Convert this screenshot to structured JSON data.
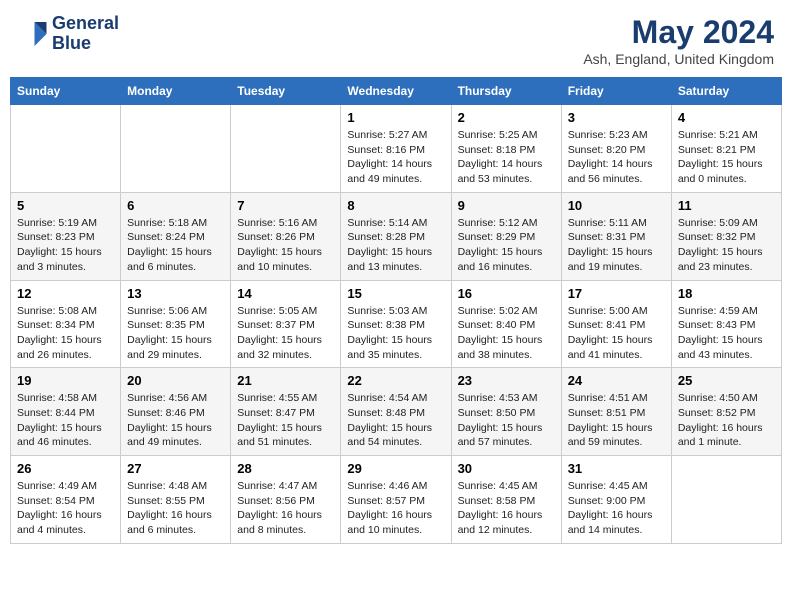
{
  "header": {
    "logo_line1": "General",
    "logo_line2": "Blue",
    "month_title": "May 2024",
    "location": "Ash, England, United Kingdom"
  },
  "weekdays": [
    "Sunday",
    "Monday",
    "Tuesday",
    "Wednesday",
    "Thursday",
    "Friday",
    "Saturday"
  ],
  "weeks": [
    [
      {
        "day": "",
        "info": ""
      },
      {
        "day": "",
        "info": ""
      },
      {
        "day": "",
        "info": ""
      },
      {
        "day": "1",
        "info": "Sunrise: 5:27 AM\nSunset: 8:16 PM\nDaylight: 14 hours\nand 49 minutes."
      },
      {
        "day": "2",
        "info": "Sunrise: 5:25 AM\nSunset: 8:18 PM\nDaylight: 14 hours\nand 53 minutes."
      },
      {
        "day": "3",
        "info": "Sunrise: 5:23 AM\nSunset: 8:20 PM\nDaylight: 14 hours\nand 56 minutes."
      },
      {
        "day": "4",
        "info": "Sunrise: 5:21 AM\nSunset: 8:21 PM\nDaylight: 15 hours\nand 0 minutes."
      }
    ],
    [
      {
        "day": "5",
        "info": "Sunrise: 5:19 AM\nSunset: 8:23 PM\nDaylight: 15 hours\nand 3 minutes."
      },
      {
        "day": "6",
        "info": "Sunrise: 5:18 AM\nSunset: 8:24 PM\nDaylight: 15 hours\nand 6 minutes."
      },
      {
        "day": "7",
        "info": "Sunrise: 5:16 AM\nSunset: 8:26 PM\nDaylight: 15 hours\nand 10 minutes."
      },
      {
        "day": "8",
        "info": "Sunrise: 5:14 AM\nSunset: 8:28 PM\nDaylight: 15 hours\nand 13 minutes."
      },
      {
        "day": "9",
        "info": "Sunrise: 5:12 AM\nSunset: 8:29 PM\nDaylight: 15 hours\nand 16 minutes."
      },
      {
        "day": "10",
        "info": "Sunrise: 5:11 AM\nSunset: 8:31 PM\nDaylight: 15 hours\nand 19 minutes."
      },
      {
        "day": "11",
        "info": "Sunrise: 5:09 AM\nSunset: 8:32 PM\nDaylight: 15 hours\nand 23 minutes."
      }
    ],
    [
      {
        "day": "12",
        "info": "Sunrise: 5:08 AM\nSunset: 8:34 PM\nDaylight: 15 hours\nand 26 minutes."
      },
      {
        "day": "13",
        "info": "Sunrise: 5:06 AM\nSunset: 8:35 PM\nDaylight: 15 hours\nand 29 minutes."
      },
      {
        "day": "14",
        "info": "Sunrise: 5:05 AM\nSunset: 8:37 PM\nDaylight: 15 hours\nand 32 minutes."
      },
      {
        "day": "15",
        "info": "Sunrise: 5:03 AM\nSunset: 8:38 PM\nDaylight: 15 hours\nand 35 minutes."
      },
      {
        "day": "16",
        "info": "Sunrise: 5:02 AM\nSunset: 8:40 PM\nDaylight: 15 hours\nand 38 minutes."
      },
      {
        "day": "17",
        "info": "Sunrise: 5:00 AM\nSunset: 8:41 PM\nDaylight: 15 hours\nand 41 minutes."
      },
      {
        "day": "18",
        "info": "Sunrise: 4:59 AM\nSunset: 8:43 PM\nDaylight: 15 hours\nand 43 minutes."
      }
    ],
    [
      {
        "day": "19",
        "info": "Sunrise: 4:58 AM\nSunset: 8:44 PM\nDaylight: 15 hours\nand 46 minutes."
      },
      {
        "day": "20",
        "info": "Sunrise: 4:56 AM\nSunset: 8:46 PM\nDaylight: 15 hours\nand 49 minutes."
      },
      {
        "day": "21",
        "info": "Sunrise: 4:55 AM\nSunset: 8:47 PM\nDaylight: 15 hours\nand 51 minutes."
      },
      {
        "day": "22",
        "info": "Sunrise: 4:54 AM\nSunset: 8:48 PM\nDaylight: 15 hours\nand 54 minutes."
      },
      {
        "day": "23",
        "info": "Sunrise: 4:53 AM\nSunset: 8:50 PM\nDaylight: 15 hours\nand 57 minutes."
      },
      {
        "day": "24",
        "info": "Sunrise: 4:51 AM\nSunset: 8:51 PM\nDaylight: 15 hours\nand 59 minutes."
      },
      {
        "day": "25",
        "info": "Sunrise: 4:50 AM\nSunset: 8:52 PM\nDaylight: 16 hours\nand 1 minute."
      }
    ],
    [
      {
        "day": "26",
        "info": "Sunrise: 4:49 AM\nSunset: 8:54 PM\nDaylight: 16 hours\nand 4 minutes."
      },
      {
        "day": "27",
        "info": "Sunrise: 4:48 AM\nSunset: 8:55 PM\nDaylight: 16 hours\nand 6 minutes."
      },
      {
        "day": "28",
        "info": "Sunrise: 4:47 AM\nSunset: 8:56 PM\nDaylight: 16 hours\nand 8 minutes."
      },
      {
        "day": "29",
        "info": "Sunrise: 4:46 AM\nSunset: 8:57 PM\nDaylight: 16 hours\nand 10 minutes."
      },
      {
        "day": "30",
        "info": "Sunrise: 4:45 AM\nSunset: 8:58 PM\nDaylight: 16 hours\nand 12 minutes."
      },
      {
        "day": "31",
        "info": "Sunrise: 4:45 AM\nSunset: 9:00 PM\nDaylight: 16 hours\nand 14 minutes."
      },
      {
        "day": "",
        "info": ""
      }
    ]
  ]
}
